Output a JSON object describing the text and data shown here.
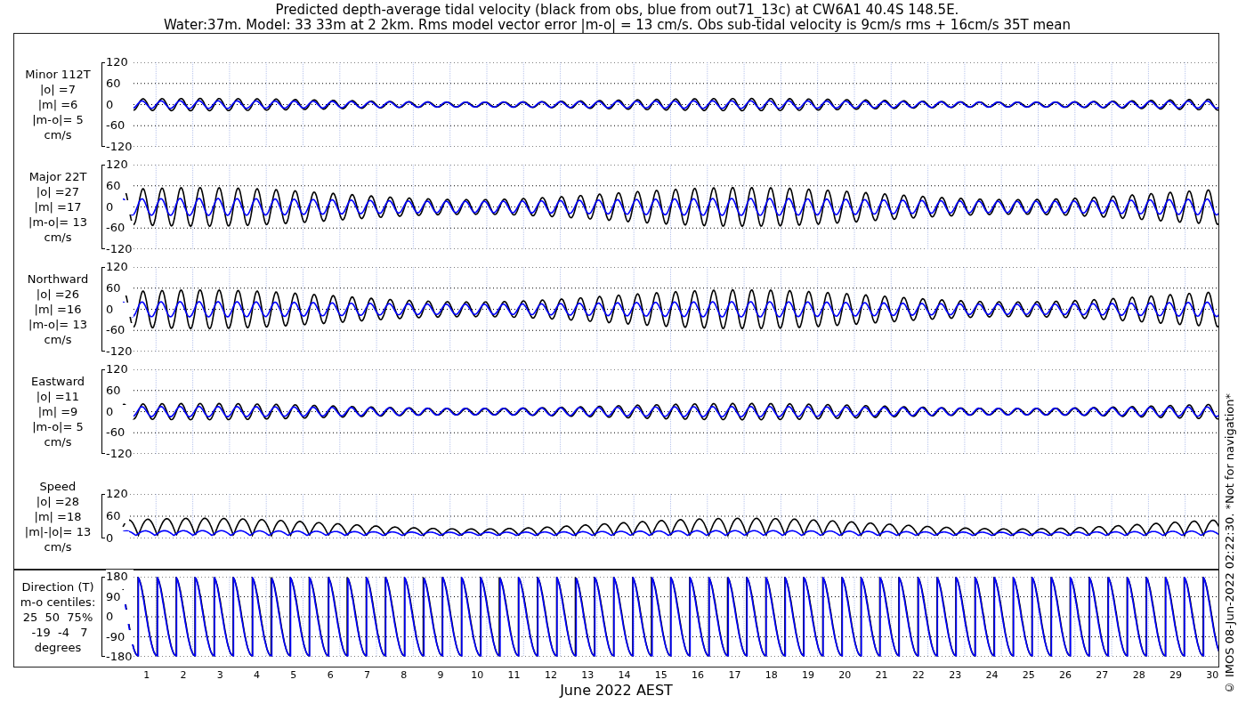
{
  "title": [
    "Predicted depth-average tidal velocity (black from obs, blue from out71_13c) at CW6A1 40.4S 148.5E.",
    "Water:37m. Model: 33 33m at 2 2km. Rms model vector error |m-o| = 13 cm/s. Obs sub-tidal velocity is 9cm/s rms + 16cm/s 35T mean"
  ],
  "panels": [
    {
      "kind": "velocity",
      "label": [
        "Minor 112T",
        "|o| =7",
        "|m| =6",
        "|m-o|= 5",
        "cm/s"
      ],
      "yticks": [
        "120",
        "60",
        "0",
        "-60",
        "-120"
      ]
    },
    {
      "kind": "velocity",
      "label": [
        "Major 22T",
        "|o| =27",
        "|m| =17",
        "|m-o|= 13",
        "cm/s"
      ],
      "yticks": [
        "120",
        "60",
        "0",
        "-60",
        "-120"
      ]
    },
    {
      "kind": "velocity",
      "label": [
        "Northward",
        "|o| =26",
        "|m| =16",
        "|m-o|= 13",
        "cm/s"
      ],
      "yticks": [
        "120",
        "60",
        "0",
        "-60",
        "-120"
      ]
    },
    {
      "kind": "velocity",
      "label": [
        "Eastward",
        "|o| =11",
        "|m| =9",
        "|m-o|= 5",
        "cm/s"
      ],
      "yticks": [
        "120",
        "60",
        "0",
        "-60",
        "-120"
      ]
    },
    {
      "kind": "speed",
      "label": [
        "Speed",
        "|o| =28",
        "|m| =18",
        "|m|-|o|= 13",
        "cm/s"
      ],
      "yticks": [
        "120",
        "60",
        "0"
      ]
    },
    {
      "kind": "direction",
      "label": [
        "Direction (T)",
        "m-o centiles:",
        "25  50  75%",
        " -19  -4   7",
        "degrees"
      ],
      "yticks": [
        "180",
        "90",
        "0",
        "-90",
        "-180"
      ]
    }
  ],
  "days": [
    "1",
    "2",
    "3",
    "4",
    "5",
    "6",
    "7",
    "8",
    "9",
    "10",
    "11",
    "12",
    "13",
    "14",
    "15",
    "16",
    "17",
    "18",
    "19",
    "20",
    "21",
    "22",
    "23",
    "24",
    "25",
    "26",
    "27",
    "28",
    "29",
    "30"
  ],
  "xlabel": "June 2022 AEST",
  "credit": "© IMOS 08-Jun-2022 02:22:30. *Not for navigation*"
}
